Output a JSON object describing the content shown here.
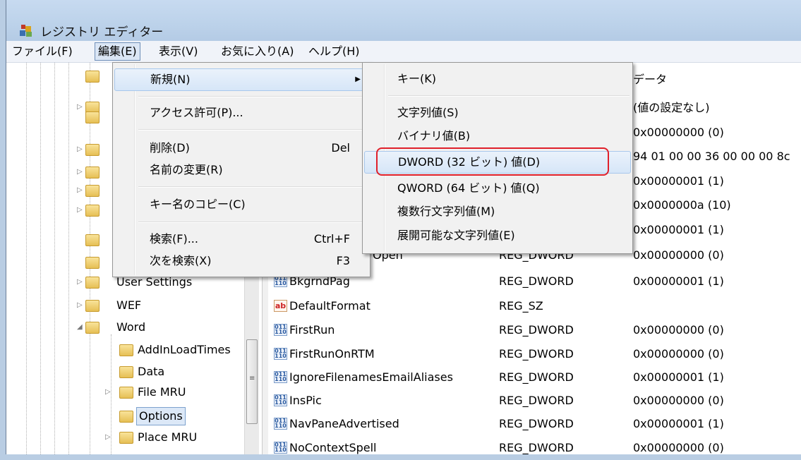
{
  "window": {
    "title": "レジストリ エディター"
  },
  "menubar": [
    "ファイル(F)",
    "編集(E)",
    "表示(V)",
    "お気に入り(A)",
    "ヘルプ(H)"
  ],
  "tree": {
    "items": [
      {
        "label": "User Settings",
        "expander": "▷"
      },
      {
        "label": "WEF",
        "expander": "▷"
      },
      {
        "label": "Word",
        "expander": "◢"
      },
      {
        "label": "AddInLoadTimes",
        "expander": ""
      },
      {
        "label": "Data",
        "expander": ""
      },
      {
        "label": "File MRU",
        "expander": "▷"
      },
      {
        "label": "Options",
        "expander": "",
        "selected": true
      },
      {
        "label": "Place MRU",
        "expander": "▷"
      }
    ]
  },
  "list": {
    "header_data": "データ",
    "rows": [
      {
        "name": "",
        "type": "",
        "data": "(値の設定なし)"
      },
      {
        "name": "",
        "type": "",
        "data": "0x00000000 (0)"
      },
      {
        "name": "",
        "type": "",
        "data": "94 01 00 00 36 00 00 00 8c"
      },
      {
        "name": "",
        "type": "",
        "data": "0x00000001 (1)"
      },
      {
        "name": "",
        "type": "",
        "data": "0x0000000a (10)"
      },
      {
        "name": "",
        "type": "",
        "data": "0x00000001 (1)"
      },
      {
        "name": "Open",
        "type": "REG_DWORD",
        "data": "0x00000000 (0)",
        "icon": ""
      },
      {
        "name": "BkgrndPag",
        "type": "REG_DWORD",
        "data": "0x00000001 (1)",
        "icon": "dword"
      },
      {
        "name": "DefaultFormat",
        "type": "REG_SZ",
        "data": "",
        "icon": "string"
      },
      {
        "name": "FirstRun",
        "type": "REG_DWORD",
        "data": "0x00000000 (0)",
        "icon": "dword"
      },
      {
        "name": "FirstRunOnRTM",
        "type": "REG_DWORD",
        "data": "0x00000000 (0)",
        "icon": "dword"
      },
      {
        "name": "IgnoreFilenamesEmailAliases",
        "type": "REG_DWORD",
        "data": "0x00000001 (1)",
        "icon": "dword"
      },
      {
        "name": "InsPic",
        "type": "REG_DWORD",
        "data": "0x00000000 (0)",
        "icon": "dword"
      },
      {
        "name": "NavPaneAdvertised",
        "type": "REG_DWORD",
        "data": "0x00000001 (1)",
        "icon": "dword"
      },
      {
        "name": "NoContextSpell",
        "type": "REG_DWORD",
        "data": "0x00000000 (0)",
        "icon": "dword"
      }
    ]
  },
  "edit_menu": {
    "new": "新規(N)",
    "permissions": "アクセス許可(P)...",
    "delete": "削除(D)",
    "delete_shortcut": "Del",
    "rename": "名前の変更(R)",
    "copy_key_name": "キー名のコピー(C)",
    "find": "検索(F)...",
    "find_shortcut": "Ctrl+F",
    "find_next": "次を検索(X)",
    "find_next_shortcut": "F3"
  },
  "new_submenu": {
    "key": "キー(K)",
    "string": "文字列値(S)",
    "binary": "バイナリ値(B)",
    "dword": "DWORD (32 ビット) 値(D)",
    "qword": "QWORD (64 ビット) 値(Q)",
    "multi_string": "複数行文字列値(M)",
    "expand_string": "展開可能な文字列値(E)"
  },
  "colors": {
    "highlight_border": "#e0202a",
    "menu_highlight": "#d6e6f8"
  }
}
